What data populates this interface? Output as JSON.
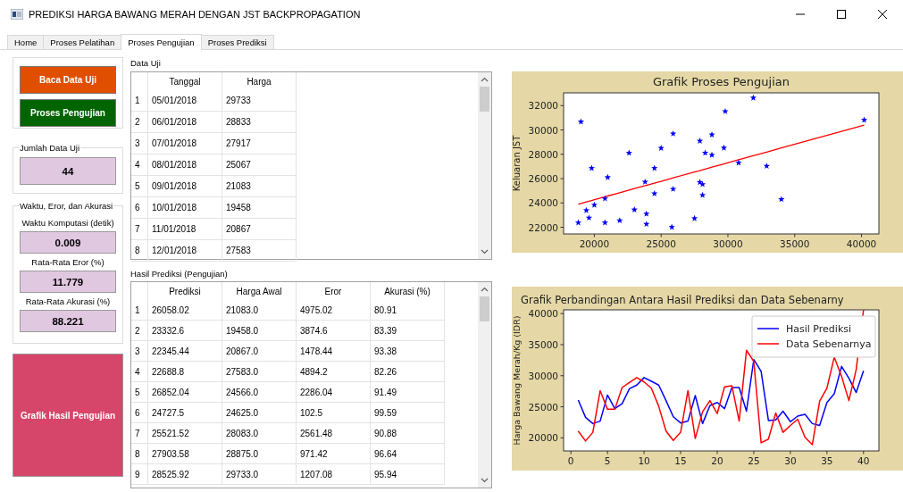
{
  "window": {
    "title": "PREDIKSI HARGA BAWANG MERAH DENGAN JST BACKPROPAGATION"
  },
  "tabs": [
    {
      "label": "Home",
      "selected": false
    },
    {
      "label": "Proses Pelatihan",
      "selected": false
    },
    {
      "label": "Proses Pengujian",
      "selected": true
    },
    {
      "label": "Proses Prediksi",
      "selected": false
    }
  ],
  "actions": [
    {
      "label": "Baca Data Uji",
      "color": "#e04e00"
    },
    {
      "label": "Proses Pengujian",
      "color": "#006400"
    }
  ],
  "jumlah_data_uji": {
    "title": "Jumlah Data Uji",
    "value": "44"
  },
  "metrics": {
    "title": "Waktu, Eror, dan Akurasi",
    "items": [
      {
        "label": "Waktu Komputasi (detik)",
        "value": "0.009"
      },
      {
        "label": "Rata-Rata Eror (%)",
        "value": "11.779"
      },
      {
        "label": "Rata-Rata Akurasi (%)",
        "value": "88.221"
      }
    ]
  },
  "graph_button": {
    "label": "Grafik Hasil Pengujian"
  },
  "data_uji": {
    "title": "Data Uji",
    "columns": [
      "Tanggal",
      "Harga"
    ],
    "rows": [
      {
        "index": "1",
        "cells": [
          "05/01/2018",
          "29733"
        ]
      },
      {
        "index": "2",
        "cells": [
          "06/01/2018",
          "28833"
        ]
      },
      {
        "index": "3",
        "cells": [
          "07/01/2018",
          "27917"
        ]
      },
      {
        "index": "4",
        "cells": [
          "08/01/2018",
          "25067"
        ]
      },
      {
        "index": "5",
        "cells": [
          "09/01/2018",
          "21083"
        ]
      },
      {
        "index": "6",
        "cells": [
          "10/01/2018",
          "19458"
        ]
      },
      {
        "index": "7",
        "cells": [
          "11/01/2018",
          "20867"
        ]
      },
      {
        "index": "8",
        "cells": [
          "12/01/2018",
          "27583"
        ]
      }
    ]
  },
  "hasil_prediksi": {
    "title": "Hasil Prediksi (Pengujian)",
    "columns": [
      "Prediksi",
      "Harga Awal",
      "Eror",
      "Akurasi (%)"
    ],
    "rows": [
      {
        "index": "1",
        "cells": [
          "26058.02",
          "21083.0",
          "4975.02",
          "80.91"
        ]
      },
      {
        "index": "2",
        "cells": [
          "23332.6",
          "19458.0",
          "3874.6",
          "83.39"
        ]
      },
      {
        "index": "3",
        "cells": [
          "22345.44",
          "20867.0",
          "1478.44",
          "93.38"
        ]
      },
      {
        "index": "4",
        "cells": [
          "22688.8",
          "27583.0",
          "4894.2",
          "82.26"
        ]
      },
      {
        "index": "5",
        "cells": [
          "26852.04",
          "24566.0",
          "2286.04",
          "91.49"
        ]
      },
      {
        "index": "6",
        "cells": [
          "24727.5",
          "24625.0",
          "102.5",
          "99.59"
        ]
      },
      {
        "index": "7",
        "cells": [
          "25521.52",
          "28083.0",
          "2561.48",
          "90.88"
        ]
      },
      {
        "index": "8",
        "cells": [
          "27903.58",
          "28875.0",
          "971.42",
          "96.64"
        ]
      },
      {
        "index": "9",
        "cells": [
          "28525.92",
          "29733.0",
          "1207.08",
          "95.94"
        ]
      }
    ]
  },
  "charts": [
    {
      "chart_data": {
        "type": "scatter",
        "title": "Grafik Proses Pengujian",
        "ylabel": "Keluaran JST",
        "x": [
          18800,
          19000,
          19800,
          21000,
          20800,
          20000,
          19400,
          19600,
          20800,
          21900,
          22600,
          23000,
          23800,
          23900,
          23900,
          24500,
          24500,
          25000,
          25800,
          25900,
          25900,
          27500,
          27900,
          27900,
          28100,
          28100,
          28300,
          28800,
          28800,
          29700,
          29800,
          30800,
          31900,
          32900,
          34000,
          40200
        ],
        "series": [
          {
            "color": "#0000ff",
            "values": [
              22380,
              30670,
              26860,
              26100,
              24350,
              23830,
              23390,
              22770,
              22380,
              22550,
              28110,
              23440,
              25730,
              23100,
              22260,
              26860,
              24770,
              28510,
              22010,
              25140,
              29690,
              22730,
              29100,
              25700,
              25530,
              24640,
              28110,
              27940,
              29610,
              28530,
              31530,
              27300,
              32640,
              27030,
              24300,
              30820
            ]
          },
          {
            "type": "line",
            "color": "#ff0000",
            "values": [
              23900,
              23960,
              24200,
              24570,
              24510,
              24260,
              24080,
              24140,
              24510,
              24840,
              25050,
              25180,
              25420,
              25450,
              25450,
              25630,
              25630,
              25780,
              26030,
              26060,
              26060,
              26540,
              26660,
              26660,
              26730,
              26730,
              26790,
              26940,
              26940,
              27210,
              27240,
              27550,
              27880,
              28180,
              28520,
              30400
            ]
          }
        ],
        "xlim": [
          17700,
          41300
        ],
        "ylim": [
          21450,
          33050
        ],
        "xticks": [
          20000,
          25000,
          30000,
          35000,
          40000
        ],
        "yticks": [
          22000,
          24000,
          26000,
          28000,
          30000,
          32000
        ]
      }
    },
    {
      "chart_data": {
        "type": "line",
        "title": "Grafik Perbandingan Antara Hasil Prediksi dan Data Sebenarny",
        "ylabel": "Harga Bawang Merah/Kg (IDR)",
        "x": [
          1,
          2,
          3,
          4,
          5,
          6,
          7,
          8,
          9,
          10,
          11,
          12,
          13,
          14,
          15,
          16,
          17,
          18,
          19,
          20,
          21,
          22,
          23,
          24,
          25,
          26,
          27,
          28,
          29,
          30,
          31,
          32,
          33,
          34,
          35,
          36,
          37,
          38,
          39,
          40
        ],
        "legend": true,
        "series": [
          {
            "name": "Hasil Prediksi",
            "color": "#0000ff",
            "values": [
              26100,
              23300,
              22300,
              22700,
              26900,
              24700,
              25500,
              27900,
              28500,
              29700,
              29100,
              28500,
              26000,
              23400,
              22400,
              22700,
              26800,
              22300,
              25200,
              25700,
              24700,
              28100,
              28100,
              24300,
              32600,
              30700,
              22800,
              22900,
              24300,
              22600,
              23500,
              23800,
              22300,
              22000,
              25700,
              27100,
              31500,
              29600,
              27300,
              30800
            ]
          },
          {
            "name": "Data Sebenarnya",
            "color": "#ff0000",
            "values": [
              21100,
              19500,
              20900,
              27600,
              24600,
              24600,
              28100,
              28900,
              29700,
              29000,
              28000,
              25100,
              21100,
              19600,
              20900,
              27600,
              19900,
              24200,
              26000,
              23900,
              28200,
              28400,
              22700,
              34100,
              32300,
              19200,
              19800,
              24000,
              20900,
              22000,
              23000,
              20100,
              18900,
              25900,
              28000,
              33000,
              29900,
              26000,
              31000,
              40600
            ]
          }
        ],
        "xlim": [
          -1,
          42.1
        ],
        "ylim": [
          17900,
          40600
        ],
        "xticks": [
          0,
          5,
          10,
          15,
          20,
          25,
          30,
          35,
          40
        ],
        "yticks": [
          20000,
          25000,
          30000,
          35000,
          40000
        ]
      }
    }
  ]
}
